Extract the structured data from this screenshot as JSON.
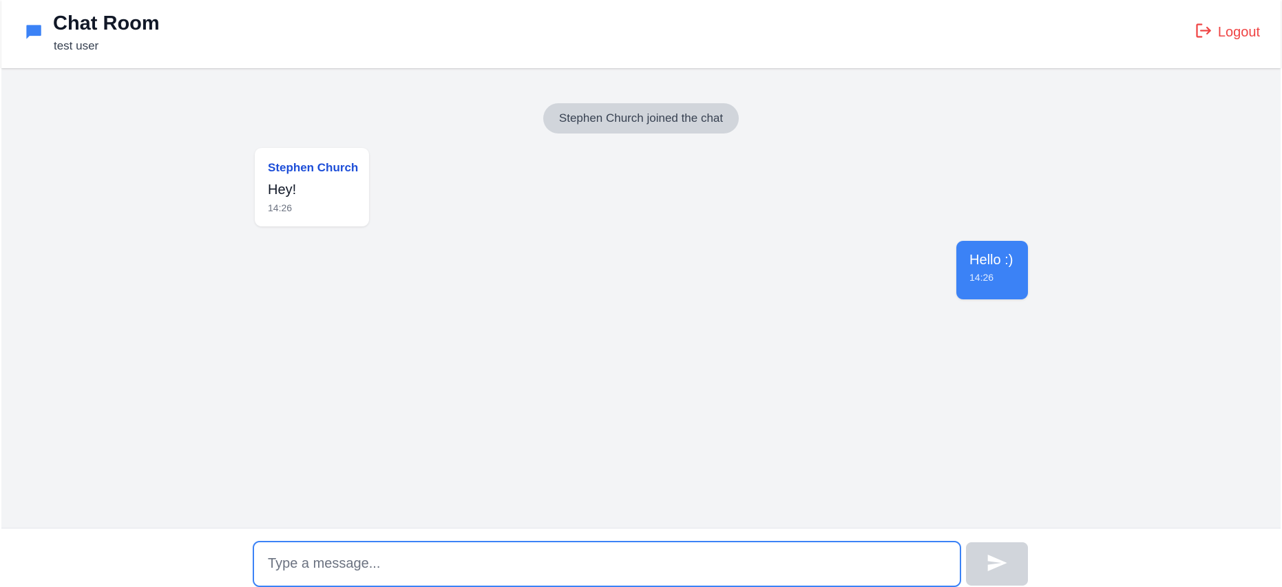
{
  "header": {
    "title": "Chat Room",
    "username": "test user",
    "logout_label": "Logout",
    "chat_icon": "chat-bubble-icon",
    "logout_icon": "logout-icon"
  },
  "messages": {
    "system": "Stephen Church joined the chat",
    "incoming": {
      "sender": "Stephen Church",
      "text": "Hey!",
      "time": "14:26"
    },
    "outgoing": {
      "text": "Hello :)",
      "time": "14:26"
    }
  },
  "composer": {
    "value": "",
    "placeholder": "Type a message...",
    "send_icon": "send-icon"
  },
  "colors": {
    "accent": "#3b82f6",
    "sender_name": "#1d4ed8",
    "logout": "#ef4444",
    "background": "#f3f4f6",
    "system_pill": "#d1d5db",
    "send_disabled": "#d1d5db"
  }
}
